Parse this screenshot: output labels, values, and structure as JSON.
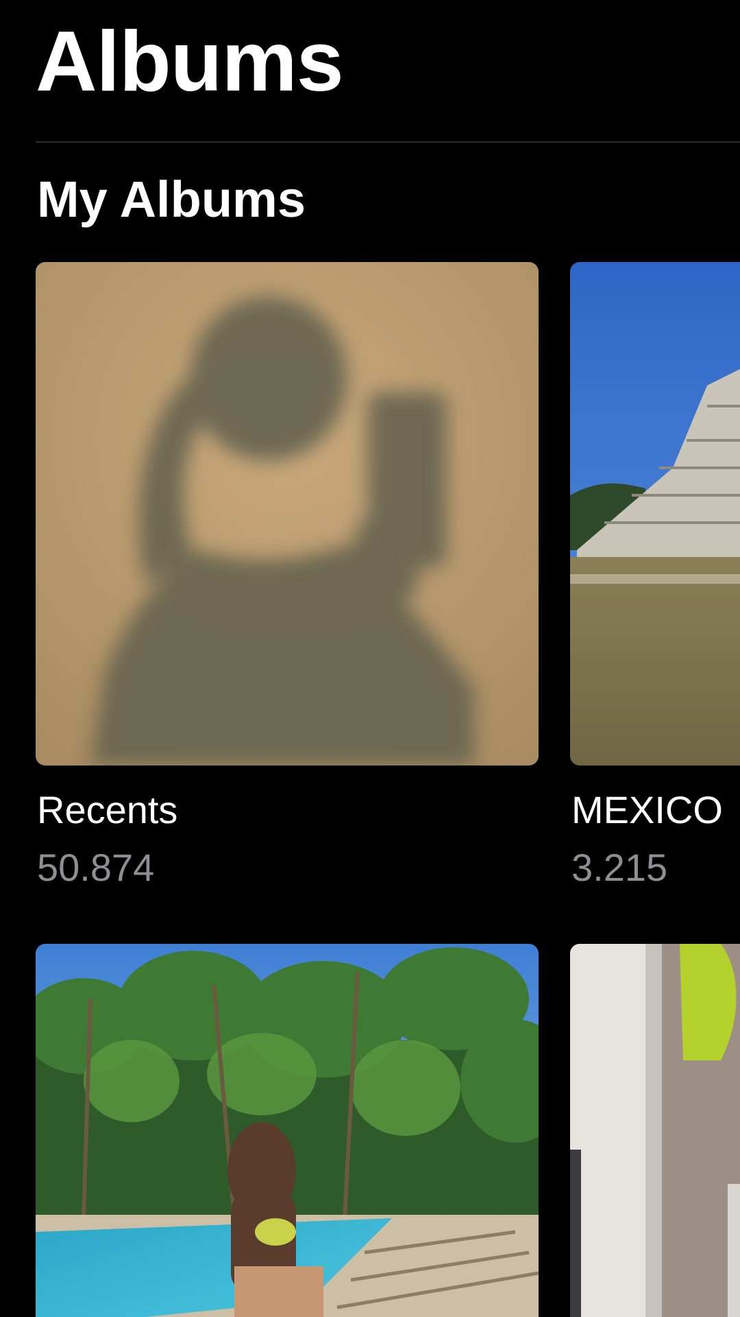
{
  "header": {
    "title": "Albums"
  },
  "sections": [
    {
      "title": "My Albums",
      "albums": [
        {
          "name": "Recents",
          "count": "50.874",
          "thumbnail_icon": "shadow-selfie-photo"
        },
        {
          "name": "MEXICO",
          "count": "3.215",
          "thumbnail_icon": "pyramid-photo"
        },
        {
          "name": "",
          "count": "",
          "thumbnail_icon": "poolside-palm-photo"
        },
        {
          "name": "",
          "count": "",
          "thumbnail_icon": "doorway-photo"
        }
      ]
    }
  ]
}
